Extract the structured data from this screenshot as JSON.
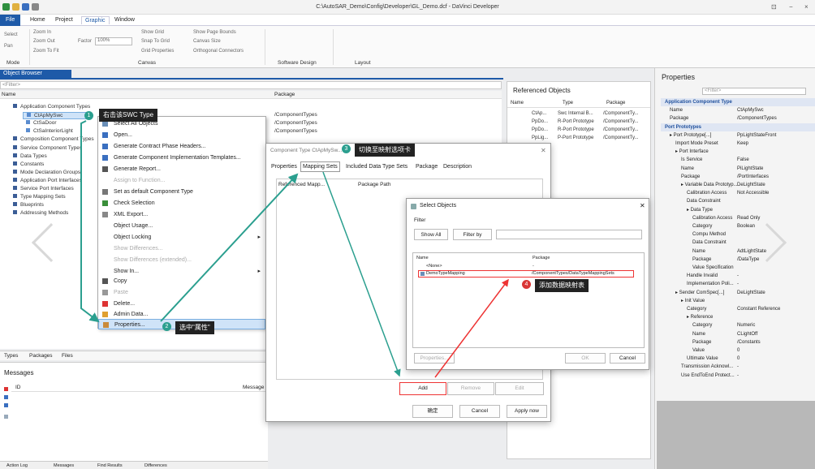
{
  "window": {
    "title": "C:\\AutoSAR_Demo\\Config\\Developer\\GL_Demo.dcf - DaVinci Developer",
    "controls": [
      "⊡",
      "−",
      "×"
    ]
  },
  "menu": {
    "file": "File",
    "home": "Home",
    "project": "Project",
    "graphic": "Graphic",
    "window": "Window"
  },
  "ribbon": {
    "select": "Select",
    "pan": "Pan",
    "mode": "Mode",
    "zoom_in": "Zoom In",
    "zoom_out": "Zoom Out",
    "zoom_to_fit": "Zoom To Fit",
    "factor": "Factor",
    "factor_value": "100%",
    "show_grid": "Show Grid",
    "snap_to_grid": "Snap To Grid",
    "grid_properties": "Grid Properties",
    "show_page_bounds": "Show Page Bounds",
    "canvas_size": "Canvas Size",
    "orthogonal_connectors": "Orthogonal Connectors",
    "canvas": "Canvas",
    "software_design": "Software Design",
    "layout": "Layout"
  },
  "object_browser": {
    "tab": "Object Browser",
    "filter": "<Filter>",
    "col_name": "Name",
    "col_package": "Package",
    "tree": [
      {
        "label": "Application Component Types",
        "level": 1
      },
      {
        "label": "CtApMySwc",
        "level": 2,
        "package": "/ComponentTypes",
        "selected": true
      },
      {
        "label": "CtSaDoor",
        "level": 2,
        "package": "/ComponentTypes"
      },
      {
        "label": "CtSaInteriorLight",
        "level": 2,
        "package": "/ComponentTypes"
      },
      {
        "label": "Composition Component Types",
        "level": 1
      },
      {
        "label": "Service Component Types",
        "level": 1
      },
      {
        "label": "Data Types",
        "level": 1
      },
      {
        "label": "Constants",
        "level": 1
      },
      {
        "label": "Mode Declaration Groups",
        "level": 1
      },
      {
        "label": "Application Port Interfaces",
        "level": 1
      },
      {
        "label": "Service Port Interfaces",
        "level": 1
      },
      {
        "label": "Type Mapping Sets",
        "level": 1
      },
      {
        "label": "Blueprints",
        "level": 1
      },
      {
        "label": "Addressing Methods",
        "level": 1
      }
    ],
    "bottom_tabs": [
      "Types",
      "Packages",
      "Files"
    ]
  },
  "messages": {
    "title": "Messages",
    "col_id": "ID",
    "col_message": "Message"
  },
  "status_tabs": [
    "Action Log",
    "Messages",
    "Find Results",
    "Differences"
  ],
  "context_menu": [
    {
      "label": "Select All Objects",
      "disabled": false
    },
    {
      "label": "Open...",
      "disabled": false
    },
    {
      "label": "Generate Contract Phase Headers...",
      "disabled": false
    },
    {
      "label": "Generate Component Implementation Templates...",
      "disabled": false
    },
    {
      "label": "Generate Report...",
      "disabled": false
    },
    {
      "label": "Assign to Function...",
      "disabled": true
    },
    {
      "label": "Set as default Component Type",
      "disabled": false
    },
    {
      "label": "Check Selection",
      "disabled": false
    },
    {
      "label": "XML Export...",
      "disabled": false
    },
    {
      "label": "Object Usage...",
      "disabled": false
    },
    {
      "label": "Object Locking",
      "disabled": false,
      "submenu": true
    },
    {
      "label": "Show Differences...",
      "disabled": true
    },
    {
      "label": "Show Differences (extended)...",
      "disabled": true
    },
    {
      "label": "Show In...",
      "disabled": false,
      "submenu": true
    },
    {
      "label": "Copy",
      "disabled": false
    },
    {
      "label": "Paste",
      "disabled": true
    },
    {
      "label": "Delete...",
      "disabled": false
    },
    {
      "label": "Admin Data...",
      "disabled": false
    },
    {
      "label": "Properties...",
      "disabled": false,
      "highlighted": true
    }
  ],
  "callouts": {
    "c1_num": "1",
    "c1": "右击该SWC Type",
    "c2_num": "2",
    "c2": "选中\"属性\"",
    "c3_num": "3",
    "c3": "切换至映射选项卡",
    "c4_num": "4",
    "c4": "添加数据映射表"
  },
  "comp_dialog": {
    "title": "Component Type CtApMySw...",
    "tabs": [
      "Properties",
      "Mapping Sets",
      "Included Data Type Sets",
      "Package",
      "Description"
    ],
    "col_ref": "Referenced Mapp...",
    "col_path": "Package Path",
    "add": "Add",
    "remove": "Remove",
    "edit": "Edit",
    "ok": "确定",
    "cancel": "Cancel",
    "apply": "Apply now"
  },
  "select_dialog": {
    "title": "Select Objects",
    "filter_label": "Filter",
    "show_all": "Show All",
    "filter_by": "Filter by",
    "col_name": "Name",
    "col_package": "Package",
    "rows": [
      {
        "name": "<None>",
        "package": "-"
      },
      {
        "name": "DemoTypeMapping",
        "package": "/ComponentTypes/DataTypeMappingSets"
      }
    ],
    "properties": "Properties...",
    "ok": "OK",
    "cancel": "Cancel"
  },
  "referenced_objects": {
    "title": "Referenced Objects",
    "col_name": "Name",
    "col_type": "Type",
    "col_package": "Package",
    "rows": [
      {
        "name": "CtAp...",
        "type": "Swc Internal B...",
        "package": "/ComponentTy..."
      },
      {
        "name": "PpDo...",
        "type": "R-Port Prototype",
        "package": "/ComponentTy..."
      },
      {
        "name": "PpDo...",
        "type": "R-Port Prototype",
        "package": "/ComponentTy..."
      },
      {
        "name": "PpLig...",
        "type": "P-Port Prototype",
        "package": "/ComponentTy..."
      }
    ]
  },
  "properties": {
    "title": "Properties",
    "filter": "<Filter>",
    "rows": [
      {
        "k": "Application Component Type",
        "v": "",
        "sec": true,
        "i": 0
      },
      {
        "k": "Name",
        "v": "CtApMySwc",
        "i": 1
      },
      {
        "k": "Package",
        "v": "/ComponentTypes",
        "i": 1
      },
      {
        "k": "Port Prototypes",
        "v": "",
        "sec": true,
        "i": 0
      },
      {
        "k": "▸ Port Prototype[...]",
        "v": "PpLightStateFront",
        "i": 1
      },
      {
        "k": "Import Mode Preset",
        "v": "Keep",
        "i": 2
      },
      {
        "k": "▸ Port Interface",
        "v": "",
        "i": 2
      },
      {
        "k": "Is Service",
        "v": "False",
        "i": 3
      },
      {
        "k": "Name",
        "v": "PiLightState",
        "i": 3
      },
      {
        "k": "Package",
        "v": "/PortInterfaces",
        "i": 3
      },
      {
        "k": "▸ Variable Data Prototyp...",
        "v": "DeLightState",
        "i": 3
      },
      {
        "k": "Calibration Access",
        "v": "Not Accessible",
        "i": 4
      },
      {
        "k": "Data Constraint",
        "v": "",
        "i": 4
      },
      {
        "k": "▸ Data Type",
        "v": "",
        "i": 4
      },
      {
        "k": "Calibration Access",
        "v": "Read Only",
        "i": 5
      },
      {
        "k": "Category",
        "v": "Boolean",
        "i": 5
      },
      {
        "k": "Compu Method",
        "v": "",
        "i": 5
      },
      {
        "k": "Data Constraint",
        "v": "",
        "i": 5
      },
      {
        "k": "Name",
        "v": "AdtLightState",
        "i": 5
      },
      {
        "k": "Package",
        "v": "/DataType",
        "i": 5
      },
      {
        "k": "Value Specification",
        "v": "",
        "i": 5
      },
      {
        "k": "Handle Invalid",
        "v": "-",
        "i": 4
      },
      {
        "k": "Implementation Poli...",
        "v": "-",
        "i": 4
      },
      {
        "k": "▸ Sender ComSpec[...]",
        "v": "DeLightState",
        "i": 2
      },
      {
        "k": "▸ Init Value",
        "v": "",
        "i": 3
      },
      {
        "k": "Category",
        "v": "Constant Reference",
        "i": 4
      },
      {
        "k": "▸ Reference",
        "v": "",
        "i": 4
      },
      {
        "k": "Category",
        "v": "Numeric",
        "i": 5
      },
      {
        "k": "Name",
        "v": "CLightOff",
        "i": 5
      },
      {
        "k": "Package",
        "v": "/Constants",
        "i": 5
      },
      {
        "k": "Value",
        "v": "0",
        "i": 5
      },
      {
        "k": "Ultimate Value",
        "v": "0",
        "i": 4
      },
      {
        "k": "Transmission Acknowl...",
        "v": "-",
        "i": 3
      },
      {
        "k": "Use EndToEnd Protect...",
        "v": "-",
        "i": 3
      }
    ]
  }
}
